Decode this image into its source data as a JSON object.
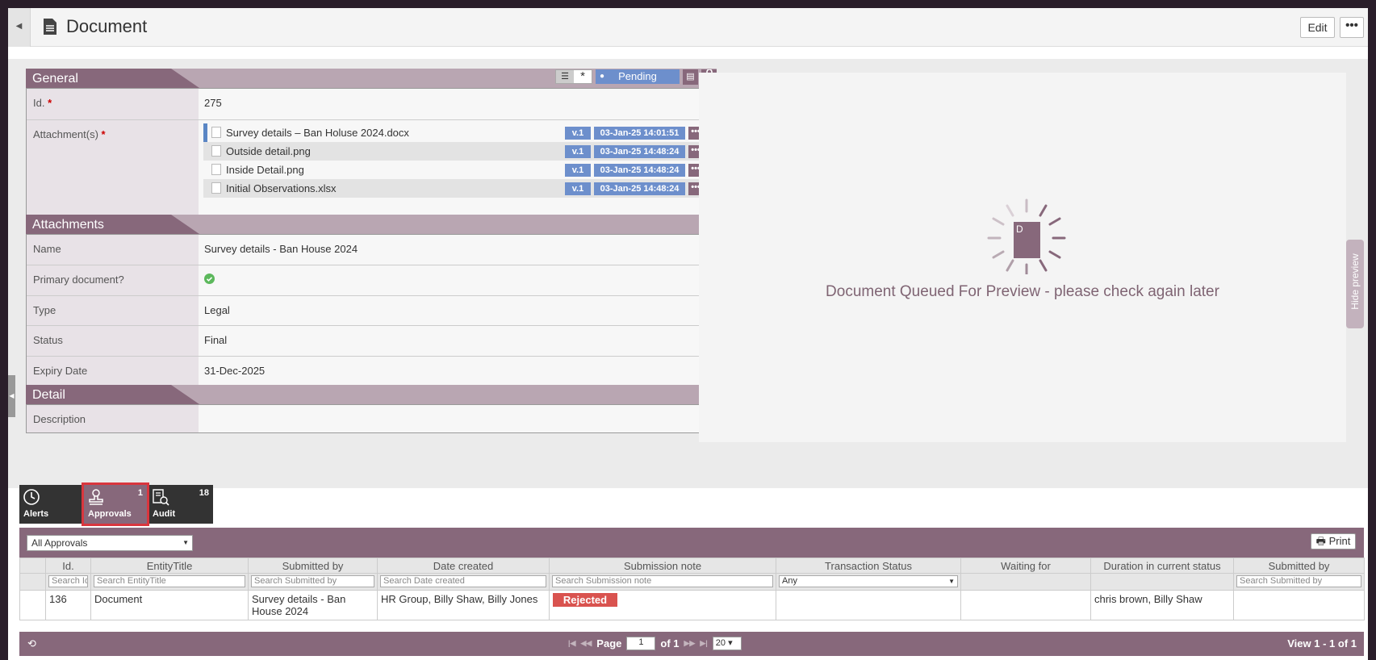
{
  "header": {
    "title": "Document",
    "edit_label": "Edit",
    "more_label": "•••"
  },
  "general": {
    "heading": "General",
    "status": "Pending",
    "id_label": "Id.",
    "id_value": "275",
    "attachments_label": "Attachment(s)",
    "files": [
      {
        "name": "Survey details – Ban Holuse 2024.docx",
        "version": "v.1",
        "date": "03-Jan-25 14:01:51"
      },
      {
        "name": "Outside detail.png",
        "version": "v.1",
        "date": "03-Jan-25 14:48:24"
      },
      {
        "name": "Inside Detail.png",
        "version": "v.1",
        "date": "03-Jan-25 14:48:24"
      },
      {
        "name": "Initial Observations.xlsx",
        "version": "v.1",
        "date": "03-Jan-25 14:48:24"
      }
    ]
  },
  "attachments": {
    "heading": "Attachments",
    "name_label": "Name",
    "name_value": "Survey details - Ban House 2024",
    "primary_label": "Primary document?",
    "type_label": "Type",
    "type_value": "Legal",
    "status_label": "Status",
    "status_value": "Final",
    "expiry_label": "Expiry Date",
    "expiry_value": "31-Dec-2025"
  },
  "detail": {
    "heading": "Detail",
    "description_label": "Description",
    "description_value": ""
  },
  "preview": {
    "icon_letter": "D",
    "message": "Document Queued For Preview - please check again later",
    "hide_label": "Hide preview"
  },
  "tabs": [
    {
      "label": "Alerts",
      "count": ""
    },
    {
      "label": "Approvals",
      "count": "1"
    },
    {
      "label": "Audit",
      "count": "18"
    }
  ],
  "grid": {
    "filter_select": "All Approvals",
    "print_label": "Print",
    "columns": [
      "Id.",
      "EntityTitle",
      "Submitted by",
      "Date created",
      "Submission note",
      "Transaction Status",
      "Waiting for",
      "Duration in current status",
      "Submitted by"
    ],
    "filters": [
      "Search Id.",
      "Search EntityTitle",
      "Search Submitted by",
      "Search Date created",
      "Search Submission note",
      "Any",
      "",
      "",
      "Search Submitted by"
    ],
    "rows": [
      {
        "id": "136",
        "entity": "Document",
        "submitted_by": "Survey details - Ban House 2024",
        "date_created": "HR Group, Billy Shaw, Billy Jones",
        "note": "Rejected",
        "status": "",
        "waiting": "",
        "duration": "chris brown, Billy Shaw",
        "submitted_by2": ""
      }
    ],
    "pager": {
      "page_label": "Page",
      "page": "1",
      "of_label": "of 1",
      "page_size": "20",
      "view_info": "View 1 - 1 of 1"
    }
  },
  "colors": {
    "accent": "#87687b",
    "blue": "#6d8fcc",
    "rejected": "#d9534f"
  }
}
